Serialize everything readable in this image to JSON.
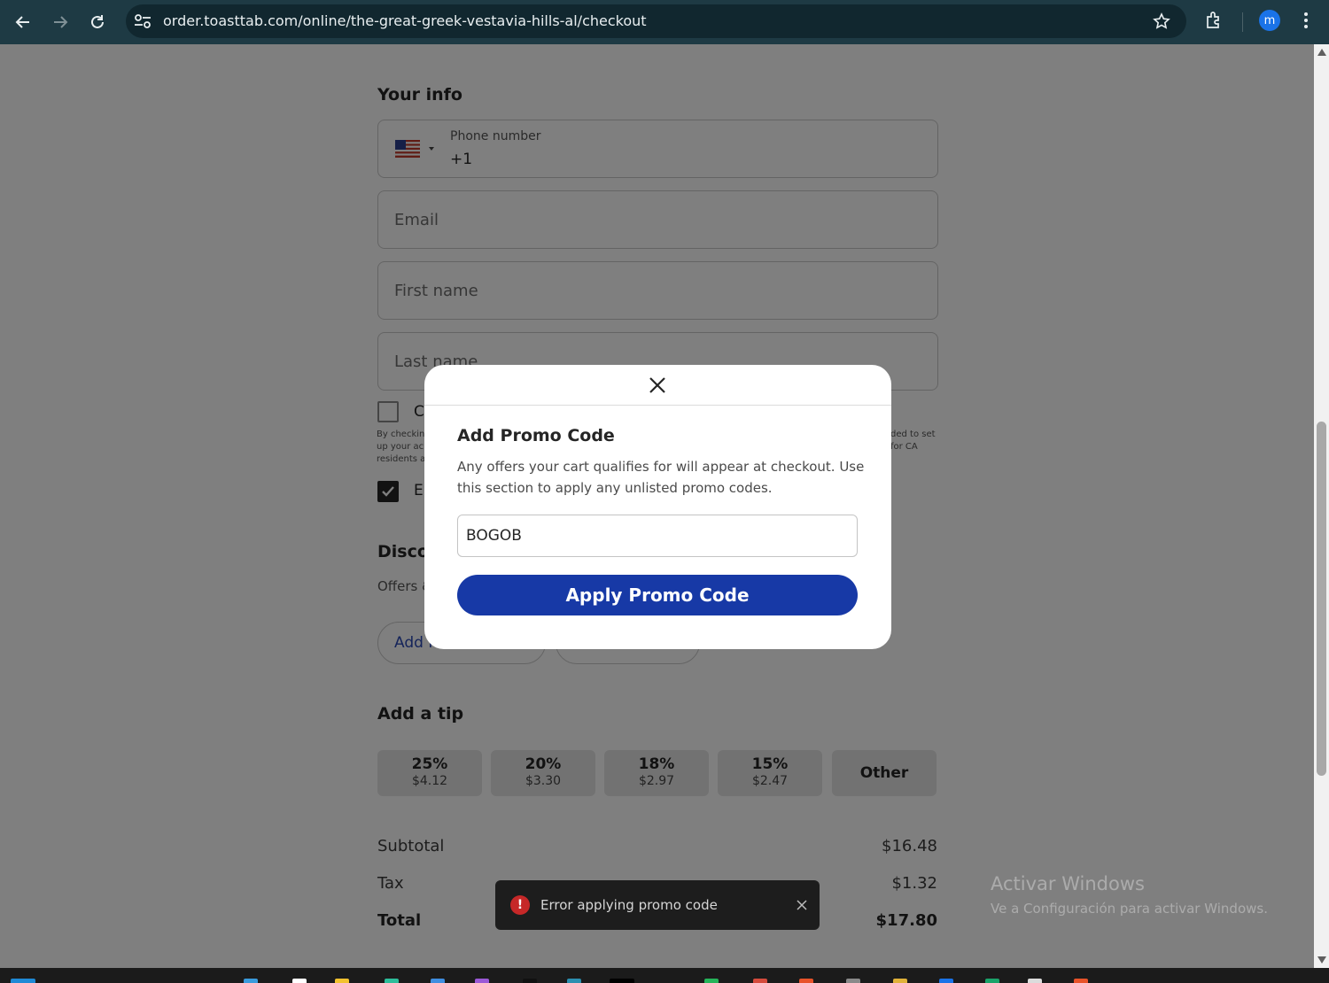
{
  "browser": {
    "url": "order.toasttab.com/online/the-great-greek-vestavia-hills-al/checkout",
    "profile_initial": "m"
  },
  "your_info": {
    "title": "Your info",
    "phone_label": "Phone number",
    "phone_value": "+1",
    "email_placeholder": "Email",
    "first_name_placeholder": "First name",
    "last_name_placeholder": "Last name",
    "opt1_label_partial": "C",
    "opt1_fine_left": [
      "By checkin",
      "up your ac",
      "residents a"
    ],
    "opt1_fine_right": [
      "ded to set",
      "for CA"
    ],
    "opt2_label_partial": "E"
  },
  "discounts": {
    "title_partial": "Disco",
    "subtitle_partial": "Offers &",
    "add_button_partial": "Add P"
  },
  "tip": {
    "title": "Add a tip",
    "options": [
      {
        "pct": "25%",
        "amt": "$4.12"
      },
      {
        "pct": "20%",
        "amt": "$3.30"
      },
      {
        "pct": "18%",
        "amt": "$2.97"
      },
      {
        "pct": "15%",
        "amt": "$2.47"
      },
      {
        "pct": "Other",
        "amt": ""
      }
    ]
  },
  "summary": {
    "subtotal_label": "Subtotal",
    "subtotal_value": "$16.48",
    "tax_label": "Tax",
    "tax_value": "$1.32",
    "total_label": "Total",
    "total_value": "$17.80"
  },
  "modal": {
    "title": "Add Promo Code",
    "description": "Any offers your cart qualifies for will appear at checkout. Use this section to apply any unlisted promo codes.",
    "input_value": "BOGOB",
    "apply_label": "Apply Promo Code"
  },
  "toast": {
    "icon": "!",
    "message": "Error applying promo code"
  },
  "watermark": {
    "line1": "Activar Windows",
    "line2": "Ve a Configuración para activar Windows."
  },
  "colors": {
    "primary": "#1739a6",
    "link": "#2b49b4",
    "error": "#c62828",
    "chrome": "#1e3a44"
  }
}
